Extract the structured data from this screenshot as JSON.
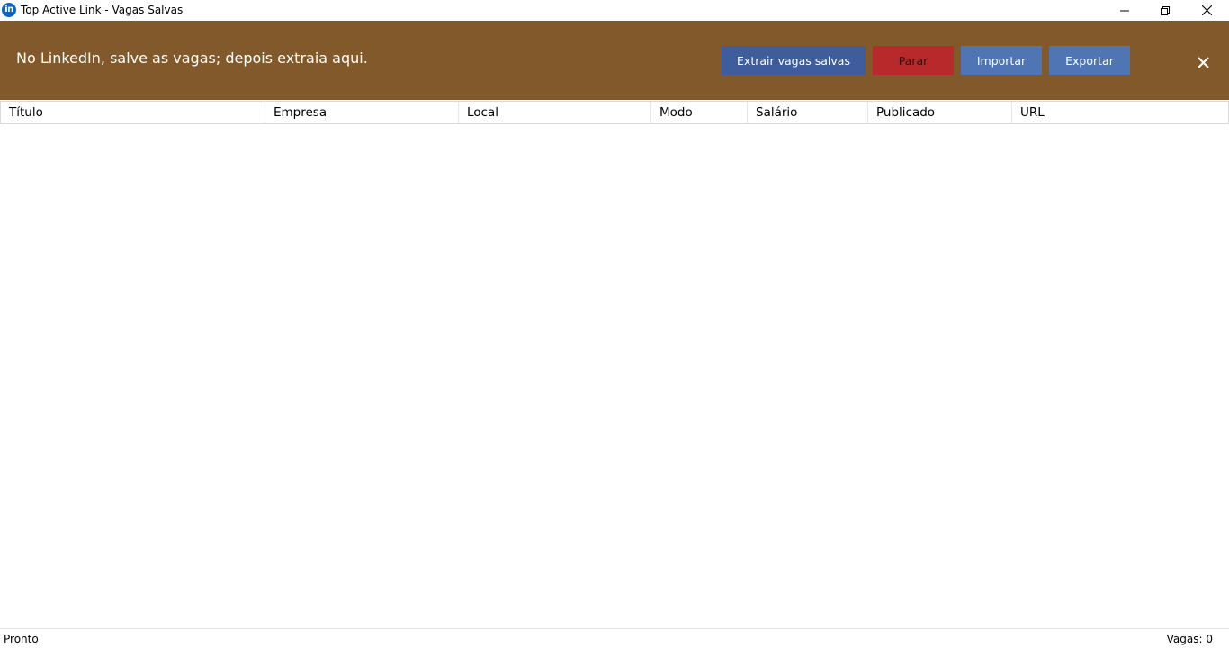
{
  "window": {
    "title": "Top Active Link - Vagas Salvas",
    "icon": "linkedin-icon",
    "icon_text": "in"
  },
  "banner": {
    "message": "No LinkedIn, salve as vagas; depois extraia aqui.",
    "buttons": {
      "extract": "Extrair vagas salvas",
      "stop": "Parar",
      "import": "Importar",
      "export": "Exportar"
    },
    "colors": {
      "background": "#82592b",
      "extract": "#3f5d9c",
      "stop": "#b8292b",
      "import_export": "#4f75b5"
    }
  },
  "table": {
    "columns": [
      "Título",
      "Empresa",
      "Local",
      "Modo",
      "Salário",
      "Publicado",
      "URL"
    ],
    "rows": []
  },
  "status": {
    "left": "Pronto",
    "right": "Vagas: 0"
  }
}
